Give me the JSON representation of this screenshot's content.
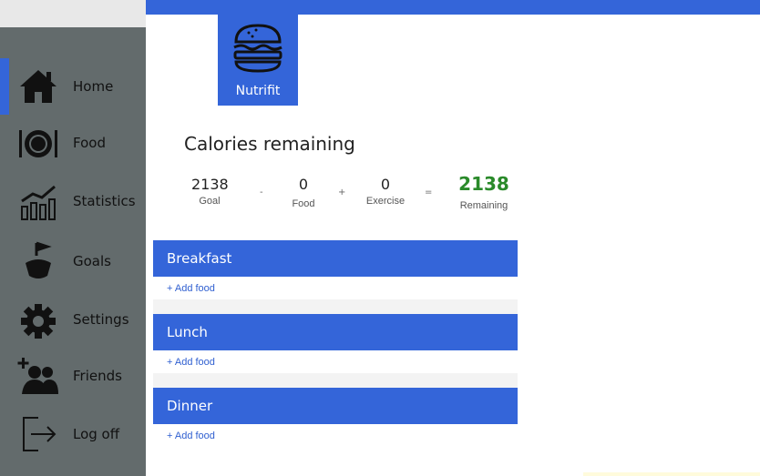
{
  "app": {
    "name": "Nutrifit",
    "accent_color": "#3465d9",
    "remaining_color": "#2a8a2a"
  },
  "sidebar": {
    "items": [
      {
        "label": "Home",
        "icon": "home-icon",
        "active": true
      },
      {
        "label": "Food",
        "icon": "plate-cutlery-icon",
        "active": false
      },
      {
        "label": "Statistics",
        "icon": "bar-chart-icon",
        "active": false
      },
      {
        "label": "Goals",
        "icon": "goals-icon",
        "active": false
      },
      {
        "label": "Settings",
        "icon": "gear-icon",
        "active": false
      },
      {
        "label": "Friends",
        "icon": "friends-icon",
        "active": false
      },
      {
        "label": "Log off",
        "icon": "log-off-icon",
        "active": false
      }
    ]
  },
  "summary": {
    "title": "Calories remaining",
    "goal": {
      "value": "2138",
      "label": "Goal"
    },
    "food": {
      "value": "0",
      "label": "Food"
    },
    "exercise": {
      "value": "0",
      "label": "Exercise"
    },
    "remaining": {
      "value": "2138",
      "label": "Remaining"
    },
    "operators": [
      "-",
      "+",
      "="
    ]
  },
  "meals": [
    {
      "name": "Breakfast",
      "add_label": "+ Add food"
    },
    {
      "name": "Lunch",
      "add_label": "+ Add food"
    },
    {
      "name": "Dinner",
      "add_label": "+ Add food"
    }
  ]
}
